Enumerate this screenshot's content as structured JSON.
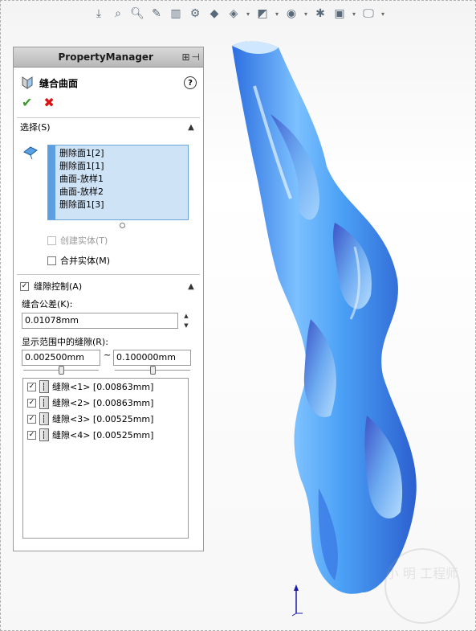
{
  "toolbar": {
    "icons": [
      "zoom-fit-icon",
      "zoom-area-icon",
      "zoom-icon",
      "section-icon",
      "view-orient-icon",
      "display-style-icon",
      "hide-show-icon",
      "appearance-icon",
      "scene-icon",
      "view-settings-icon",
      "monitor-icon"
    ]
  },
  "property_manager": {
    "header_title": "PropertyManager",
    "feature_name": "缝合曲面",
    "help_label": "?",
    "ok_label": "✔",
    "cancel_label": "✖",
    "selection": {
      "title": "选择(S)",
      "items": [
        "删除面1[2]",
        "删除面1[1]",
        "曲面-放样1",
        "曲面-放样2",
        "删除面1[3]"
      ],
      "create_solid": {
        "label": "创建实体(T)",
        "checked": false,
        "enabled": false
      },
      "merge_entities": {
        "label": "合并实体(M)",
        "checked": false,
        "enabled": true
      }
    },
    "gap_control": {
      "title": "缝隙控制(A)",
      "checked": true,
      "tolerance_label": "缝合公差(K):",
      "tolerance_value": "0.01078mm",
      "range_label": "显示范围中的缝隙(R):",
      "range_min": "0.002500mm",
      "range_sep": "~",
      "range_max": "0.100000mm",
      "slider_min_pos": 0.5,
      "slider_max_pos": 0.5,
      "gaps": [
        {
          "label": "缝隙<1> [0.00863mm]",
          "checked": true
        },
        {
          "label": "缝隙<2> [0.00863mm]",
          "checked": true
        },
        {
          "label": "缝隙<3> [0.00525mm]",
          "checked": true
        },
        {
          "label": "缝隙<4> [0.00525mm]",
          "checked": true
        }
      ]
    }
  },
  "watermark": {
    "text": "小 明 工程师"
  },
  "colors": {
    "model_light": "#8cc8ff",
    "model_mid": "#3b8ff0",
    "model_dark": "#2c5fd0",
    "selection_bg": "#cfe3f7",
    "selection_stripe": "#5d9ee0",
    "ok": "#3a9b2b",
    "cancel": "#dd1111"
  }
}
